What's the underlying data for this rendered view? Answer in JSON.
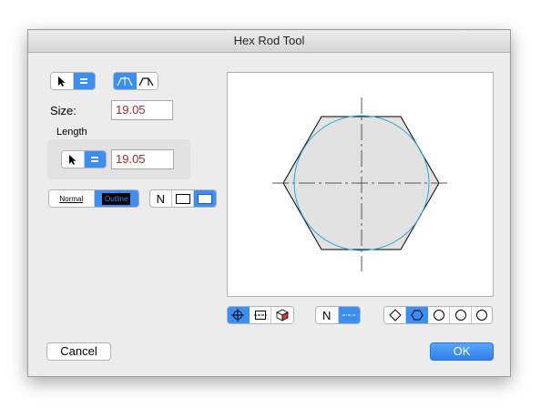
{
  "window": {
    "title": "Hex Rod Tool"
  },
  "size": {
    "label": "Size:",
    "value": "19.05"
  },
  "length": {
    "label": "Length",
    "value": "19.05"
  },
  "style_toggle": {
    "normal_label": "Normal",
    "outline_label": "Outline",
    "selected": "Outline"
  },
  "fill_toggle": {
    "n_label": "N",
    "selected": 2
  },
  "view_toggle": {
    "selected": 0
  },
  "line_toggle": {
    "n_label": "N",
    "selected": 1
  },
  "profile_toggle": {
    "selected": 1
  },
  "buttons": {
    "cancel": "Cancel",
    "ok": "OK"
  },
  "colors": {
    "accent": "#3b8ef4",
    "input_text": "#a12a2a",
    "circle": "#29a8d8",
    "hex_fill": "#e2e2e2"
  }
}
